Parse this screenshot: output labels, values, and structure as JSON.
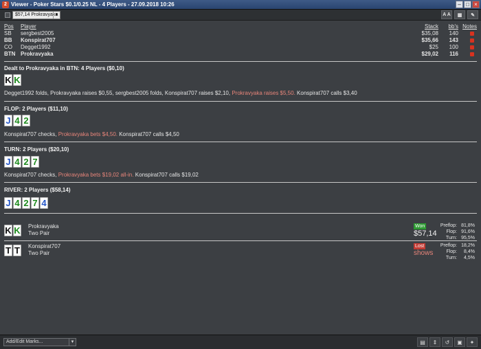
{
  "window": {
    "title": "Viewer - Poker Stars $0.1/0.25 NL - 4 Players - 27.09.2018 10:26"
  },
  "toolbar": {
    "hand_selector": "$57,14 Prokravyaka",
    "font_btn": "A A"
  },
  "players": {
    "headers": {
      "pos": "Pos",
      "player": "Player",
      "stack": "Stack",
      "bb": "bb's",
      "notes": "Notes"
    },
    "rows": [
      {
        "pos": "SB",
        "name": "sergbest2005",
        "stack": "$35,08",
        "bb": "140"
      },
      {
        "pos": "BB",
        "name": "Konspirat707",
        "stack": "$35,66",
        "bb": "143"
      },
      {
        "pos": "CO",
        "name": "Degget1992",
        "stack": "$25",
        "bb": "100"
      },
      {
        "pos": "BTN",
        "name": "Prokravyaka",
        "stack": "$29,02",
        "bb": "116"
      }
    ]
  },
  "preflop": {
    "title": "Dealt to Prokravyaka in BTN: 4 Players ($0,10)",
    "cards": [
      {
        "rank": "K",
        "suit": "spade"
      },
      {
        "rank": "K",
        "suit": "club"
      }
    ],
    "a1": "Degget1992 folds, Prokravyaka raises $0,55, sergbest2005 folds, Konspirat707 raises $2,10, ",
    "a2": "Prokravyaka raises $5,50.",
    "a3": " Konspirat707 calls $3,40"
  },
  "flop": {
    "title": "FLOP: 2 Players ($11,10)",
    "cards": [
      {
        "rank": "J",
        "suit": "diamond"
      },
      {
        "rank": "4",
        "suit": "club"
      },
      {
        "rank": "2",
        "suit": "club"
      }
    ],
    "a1": "Konspirat707 checks, ",
    "a2": "Prokravyaka bets $4,50.",
    "a3": " Konspirat707 calls $4,50"
  },
  "turn": {
    "title": "TURN: 2 Players ($20,10)",
    "cards": [
      {
        "rank": "J",
        "suit": "diamond"
      },
      {
        "rank": "4",
        "suit": "club"
      },
      {
        "rank": "2",
        "suit": "club"
      },
      {
        "rank": "7",
        "suit": "club"
      }
    ],
    "a1": "Konspirat707 checks, ",
    "a2": "Prokravyaka bets $19,02 all-in.",
    "a3": " Konspirat707 calls $19,02"
  },
  "river": {
    "title": "RIVER: 2 Players ($58,14)",
    "cards": [
      {
        "rank": "J",
        "suit": "diamond"
      },
      {
        "rank": "4",
        "suit": "club"
      },
      {
        "rank": "2",
        "suit": "club"
      },
      {
        "rank": "7",
        "suit": "club"
      },
      {
        "rank": "4",
        "suit": "diamond"
      }
    ]
  },
  "results": [
    {
      "name": "Prokravyaka",
      "hand": "Two Pair",
      "badge": "Won",
      "amount": "$57,14",
      "cards": [
        {
          "rank": "K",
          "suit": "spade"
        },
        {
          "rank": "K",
          "suit": "club"
        }
      ],
      "equity": [
        {
          "label": "Preflop:",
          "value": "81,8%"
        },
        {
          "label": "Flop:",
          "value": "91,6%"
        },
        {
          "label": "Turn:",
          "value": "95,5%"
        }
      ]
    },
    {
      "name": "Konspirat707",
      "hand": "Two Pair",
      "badge": "Lost",
      "amount": "shows",
      "cards": [
        {
          "rank": "T",
          "suit": "spade"
        },
        {
          "rank": "T",
          "suit": "spade"
        }
      ],
      "equity": [
        {
          "label": "Preflop:",
          "value": "18,2%"
        },
        {
          "label": "Flop:",
          "value": "8,4%"
        },
        {
          "label": "Turn:",
          "value": "4,5%"
        }
      ]
    }
  ],
  "statusbar": {
    "marks": "Add/Edit Marks..."
  },
  "colors": {
    "highlight": "#e8857a",
    "won": "#2e9a33",
    "lost": "#c23a33",
    "club": "#1d8a1d",
    "diamond": "#2456c7"
  }
}
